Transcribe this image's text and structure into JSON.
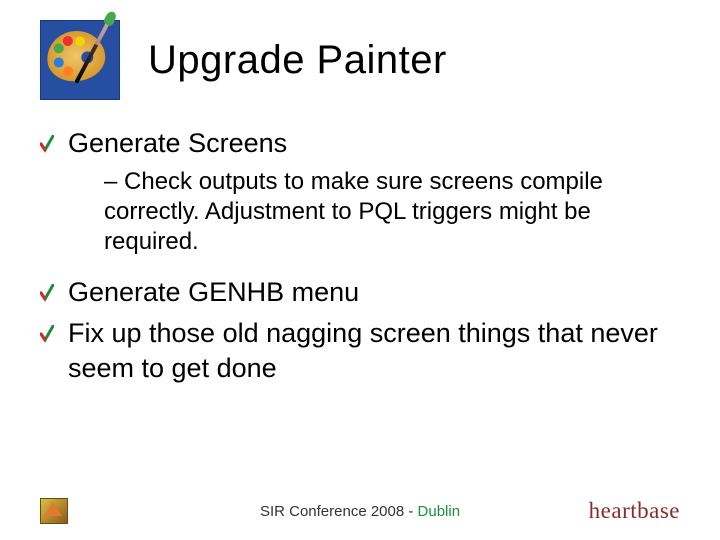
{
  "header": {
    "title": "Upgrade Painter",
    "icon_name": "painter-palette-icon"
  },
  "bullets": [
    {
      "text": "Generate Screens",
      "sub": "– Check outputs to make sure screens compile correctly.  Adjustment to PQL triggers might be required."
    },
    {
      "text": "Generate GENHB menu"
    },
    {
      "text": "Fix up those old nagging screen things that never seem to get done"
    }
  ],
  "footer": {
    "text_prefix": "SIR Conference 2008 - ",
    "text_accent": "Dublin",
    "brand": "heartbase",
    "corner_icon_name": "conference-logo-icon"
  }
}
